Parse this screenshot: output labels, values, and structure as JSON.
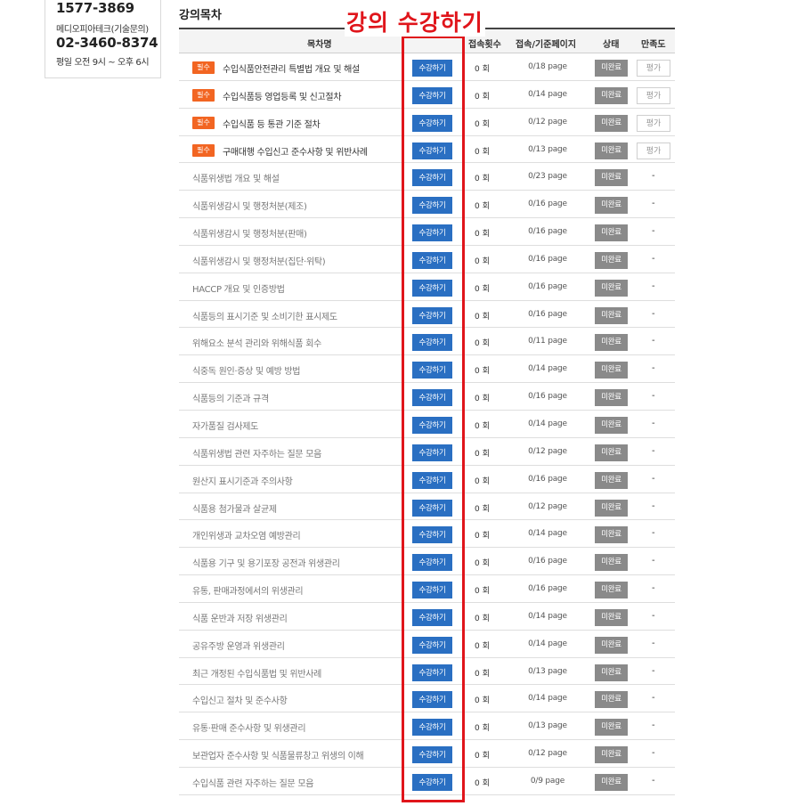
{
  "contact": {
    "phone1": "1577-3869",
    "sub": "메디오피아테크(기술문의)",
    "phone2": "02-3460-8374",
    "hours": "평일 오전 9시 ~ 오후 6시"
  },
  "section_title": "강의목차",
  "annotation": "강의 수강하기",
  "table": {
    "headers": {
      "title": "목차명",
      "count": "접속횟수",
      "pages": "접속/기준페이지",
      "status": "상태",
      "satisfaction": "만족도"
    },
    "rows": [
      {
        "required": true,
        "badge": "필수",
        "title": "수입식품안전관리 특별법 개요 및 해설",
        "enroll": "수강하기",
        "count": "0 회",
        "pages": "0/18 page",
        "status": "미완료",
        "rate": "평가"
      },
      {
        "required": true,
        "badge": "필수",
        "title": "수입식품등 영업등록 및 신고절차",
        "enroll": "수강하기",
        "count": "0 회",
        "pages": "0/14 page",
        "status": "미완료",
        "rate": "평가"
      },
      {
        "required": true,
        "badge": "필수",
        "title": "수입식품 등 통관 기준 절차",
        "enroll": "수강하기",
        "count": "0 회",
        "pages": "0/12 page",
        "status": "미완료",
        "rate": "평가"
      },
      {
        "required": true,
        "badge": "필수",
        "title": "구매대행 수입신고 준수사항 및 위반사례",
        "enroll": "수강하기",
        "count": "0 회",
        "pages": "0/13 page",
        "status": "미완료",
        "rate": "평가"
      },
      {
        "required": false,
        "title": "식품위생법 개요 및 해설",
        "enroll": "수강하기",
        "count": "0 회",
        "pages": "0/23 page",
        "status": "미완료",
        "rate": "-"
      },
      {
        "required": false,
        "title": "식품위생감시 및 행정처분(제조)",
        "enroll": "수강하기",
        "count": "0 회",
        "pages": "0/16 page",
        "status": "미완료",
        "rate": "-"
      },
      {
        "required": false,
        "title": "식품위생감시 및 행정처분(판매)",
        "enroll": "수강하기",
        "count": "0 회",
        "pages": "0/16 page",
        "status": "미완료",
        "rate": "-"
      },
      {
        "required": false,
        "title": "식품위생감시 및 행정처분(집단·위탁)",
        "enroll": "수강하기",
        "count": "0 회",
        "pages": "0/16 page",
        "status": "미완료",
        "rate": "-"
      },
      {
        "required": false,
        "title": "HACCP 개요 및 인증방법",
        "enroll": "수강하기",
        "count": "0 회",
        "pages": "0/16 page",
        "status": "미완료",
        "rate": "-"
      },
      {
        "required": false,
        "title": "식품등의 표시기준 및 소비기한 표시제도",
        "enroll": "수강하기",
        "count": "0 회",
        "pages": "0/16 page",
        "status": "미완료",
        "rate": "-"
      },
      {
        "required": false,
        "title": "위해요소 분석 관리와 위해식품 회수",
        "enroll": "수강하기",
        "count": "0 회",
        "pages": "0/11 page",
        "status": "미완료",
        "rate": "-"
      },
      {
        "required": false,
        "title": "식중독 원인·증상 및 예방 방법",
        "enroll": "수강하기",
        "count": "0 회",
        "pages": "0/14 page",
        "status": "미완료",
        "rate": "-"
      },
      {
        "required": false,
        "title": "식품등의 기준과 규격",
        "enroll": "수강하기",
        "count": "0 회",
        "pages": "0/16 page",
        "status": "미완료",
        "rate": "-"
      },
      {
        "required": false,
        "title": "자가품질 검사제도",
        "enroll": "수강하기",
        "count": "0 회",
        "pages": "0/14 page",
        "status": "미완료",
        "rate": "-"
      },
      {
        "required": false,
        "title": "식품위생법 관련 자주하는 질문 모음",
        "enroll": "수강하기",
        "count": "0 회",
        "pages": "0/12 page",
        "status": "미완료",
        "rate": "-"
      },
      {
        "required": false,
        "title": "원산지 표시기준과 주의사항",
        "enroll": "수강하기",
        "count": "0 회",
        "pages": "0/16 page",
        "status": "미완료",
        "rate": "-"
      },
      {
        "required": false,
        "title": "식품용 첨가물과 살균제",
        "enroll": "수강하기",
        "count": "0 회",
        "pages": "0/12 page",
        "status": "미완료",
        "rate": "-"
      },
      {
        "required": false,
        "title": "개인위생과 교차오염 예방관리",
        "enroll": "수강하기",
        "count": "0 회",
        "pages": "0/14 page",
        "status": "미완료",
        "rate": "-"
      },
      {
        "required": false,
        "title": "식품용 기구 및 용기포장 공전과 위생관리",
        "enroll": "수강하기",
        "count": "0 회",
        "pages": "0/16 page",
        "status": "미완료",
        "rate": "-"
      },
      {
        "required": false,
        "title": "유통, 판매과정에서의 위생관리",
        "enroll": "수강하기",
        "count": "0 회",
        "pages": "0/16 page",
        "status": "미완료",
        "rate": "-"
      },
      {
        "required": false,
        "title": "식품 운반과 저장 위생관리",
        "enroll": "수강하기",
        "count": "0 회",
        "pages": "0/14 page",
        "status": "미완료",
        "rate": "-"
      },
      {
        "required": false,
        "title": "공유주방 운영과 위생관리",
        "enroll": "수강하기",
        "count": "0 회",
        "pages": "0/14 page",
        "status": "미완료",
        "rate": "-"
      },
      {
        "required": false,
        "title": "최근 개정된 수입식품법 및 위반사례",
        "enroll": "수강하기",
        "count": "0 회",
        "pages": "0/13 page",
        "status": "미완료",
        "rate": "-"
      },
      {
        "required": false,
        "title": "수입신고 절차 및 준수사항",
        "enroll": "수강하기",
        "count": "0 회",
        "pages": "0/14 page",
        "status": "미완료",
        "rate": "-"
      },
      {
        "required": false,
        "title": "유통·판매 준수사항 및 위생관리",
        "enroll": "수강하기",
        "count": "0 회",
        "pages": "0/13 page",
        "status": "미완료",
        "rate": "-"
      },
      {
        "required": false,
        "title": "보관업자 준수사항 및 식품물류창고 위생의 이해",
        "enroll": "수강하기",
        "count": "0 회",
        "pages": "0/12 page",
        "status": "미완료",
        "rate": "-"
      },
      {
        "required": false,
        "title": "수입식품 관련 자주하는 질문 모음",
        "enroll": "수강하기",
        "count": "0 회",
        "pages": "0/9 page",
        "status": "미완료",
        "rate": "-"
      }
    ]
  },
  "colors": {
    "required_badge": "#f26522",
    "enroll_button": "#2a6fc2",
    "status_badge": "#8a8a8a",
    "annotation": "#e0151b"
  }
}
